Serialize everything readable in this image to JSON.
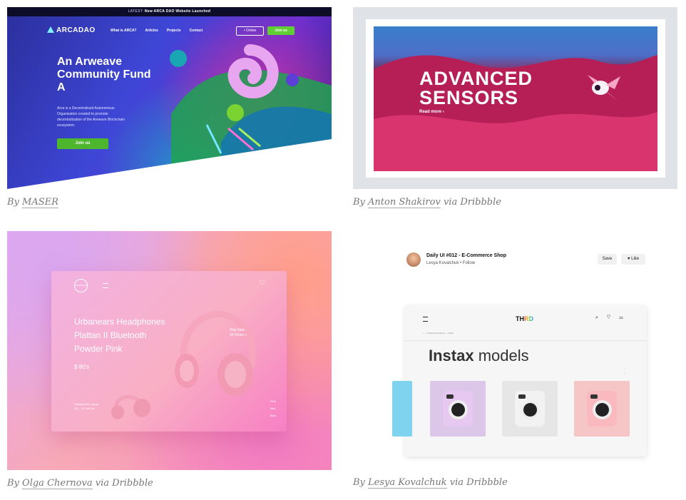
{
  "cards": [
    {
      "caption_by": "By",
      "author": "MASER",
      "via": "",
      "screen": {
        "topbar_latest": "LATEST:",
        "topbar_text": "New ARCA DAO Website Launched",
        "logo": "ARCADAO",
        "nav": [
          "What is ARCA?",
          "Articles",
          "Projects",
          "Contact"
        ],
        "online_button": "• Online",
        "join_button_top": "Join us",
        "headline": "An Arweave Community Fund A",
        "description": "Arca is a Decentralised Autonomous Organisation created to promote decentralization of the Arweave Blockchain ecosystem.",
        "join_button": "Join us"
      }
    },
    {
      "caption_by": "By",
      "author": "Anton Shakirov",
      "via": "via Dribbble",
      "screen": {
        "headline_line1": "ADVANCED",
        "headline_line2": "SENSORS",
        "read_more": "Read more ›"
      }
    },
    {
      "caption_by": "By",
      "author": "Olga Chernova",
      "via": "via Dribbble",
      "screen": {
        "logo": "URBANEARS",
        "product_line1": "Urbanears Headphones",
        "product_line2": "Plattan II Bluetooth",
        "product_line3": "Powder Pink",
        "price": "$ 80's",
        "play_now": "Play Now",
        "play_sub": "30 Hours +",
        "range_label": "Headphones range",
        "range_value": "20 — 20 000 Hz",
        "swatches": [
          "Pink",
          "Red",
          "Blue"
        ]
      }
    },
    {
      "caption_by": "By",
      "author": "Lesya Kovalchuk",
      "via": "via Dribbble",
      "screen": {
        "shot_title": "Daily UI #012 - E-Commerce Shop",
        "shot_author": "Lesya Kovalchuk",
        "follow": "Follow",
        "save_button": "Save",
        "like_button": "♥ Like",
        "brand_prefix": "TH",
        "brand_suffix": "RD",
        "breadcrumb": "⌂ — Polaroid Cameras — Instax",
        "heading_bold": "Instax",
        "heading_rest": " models",
        "tile_colors": [
          "#7fd3ee",
          "#dcc7e8",
          "#e6e6e6",
          "#f6c5c6"
        ],
        "camera_colors": [
          "#9fdff2",
          "#e7c8f0",
          "#f2f2f2",
          "#f9b9bf"
        ]
      }
    }
  ]
}
